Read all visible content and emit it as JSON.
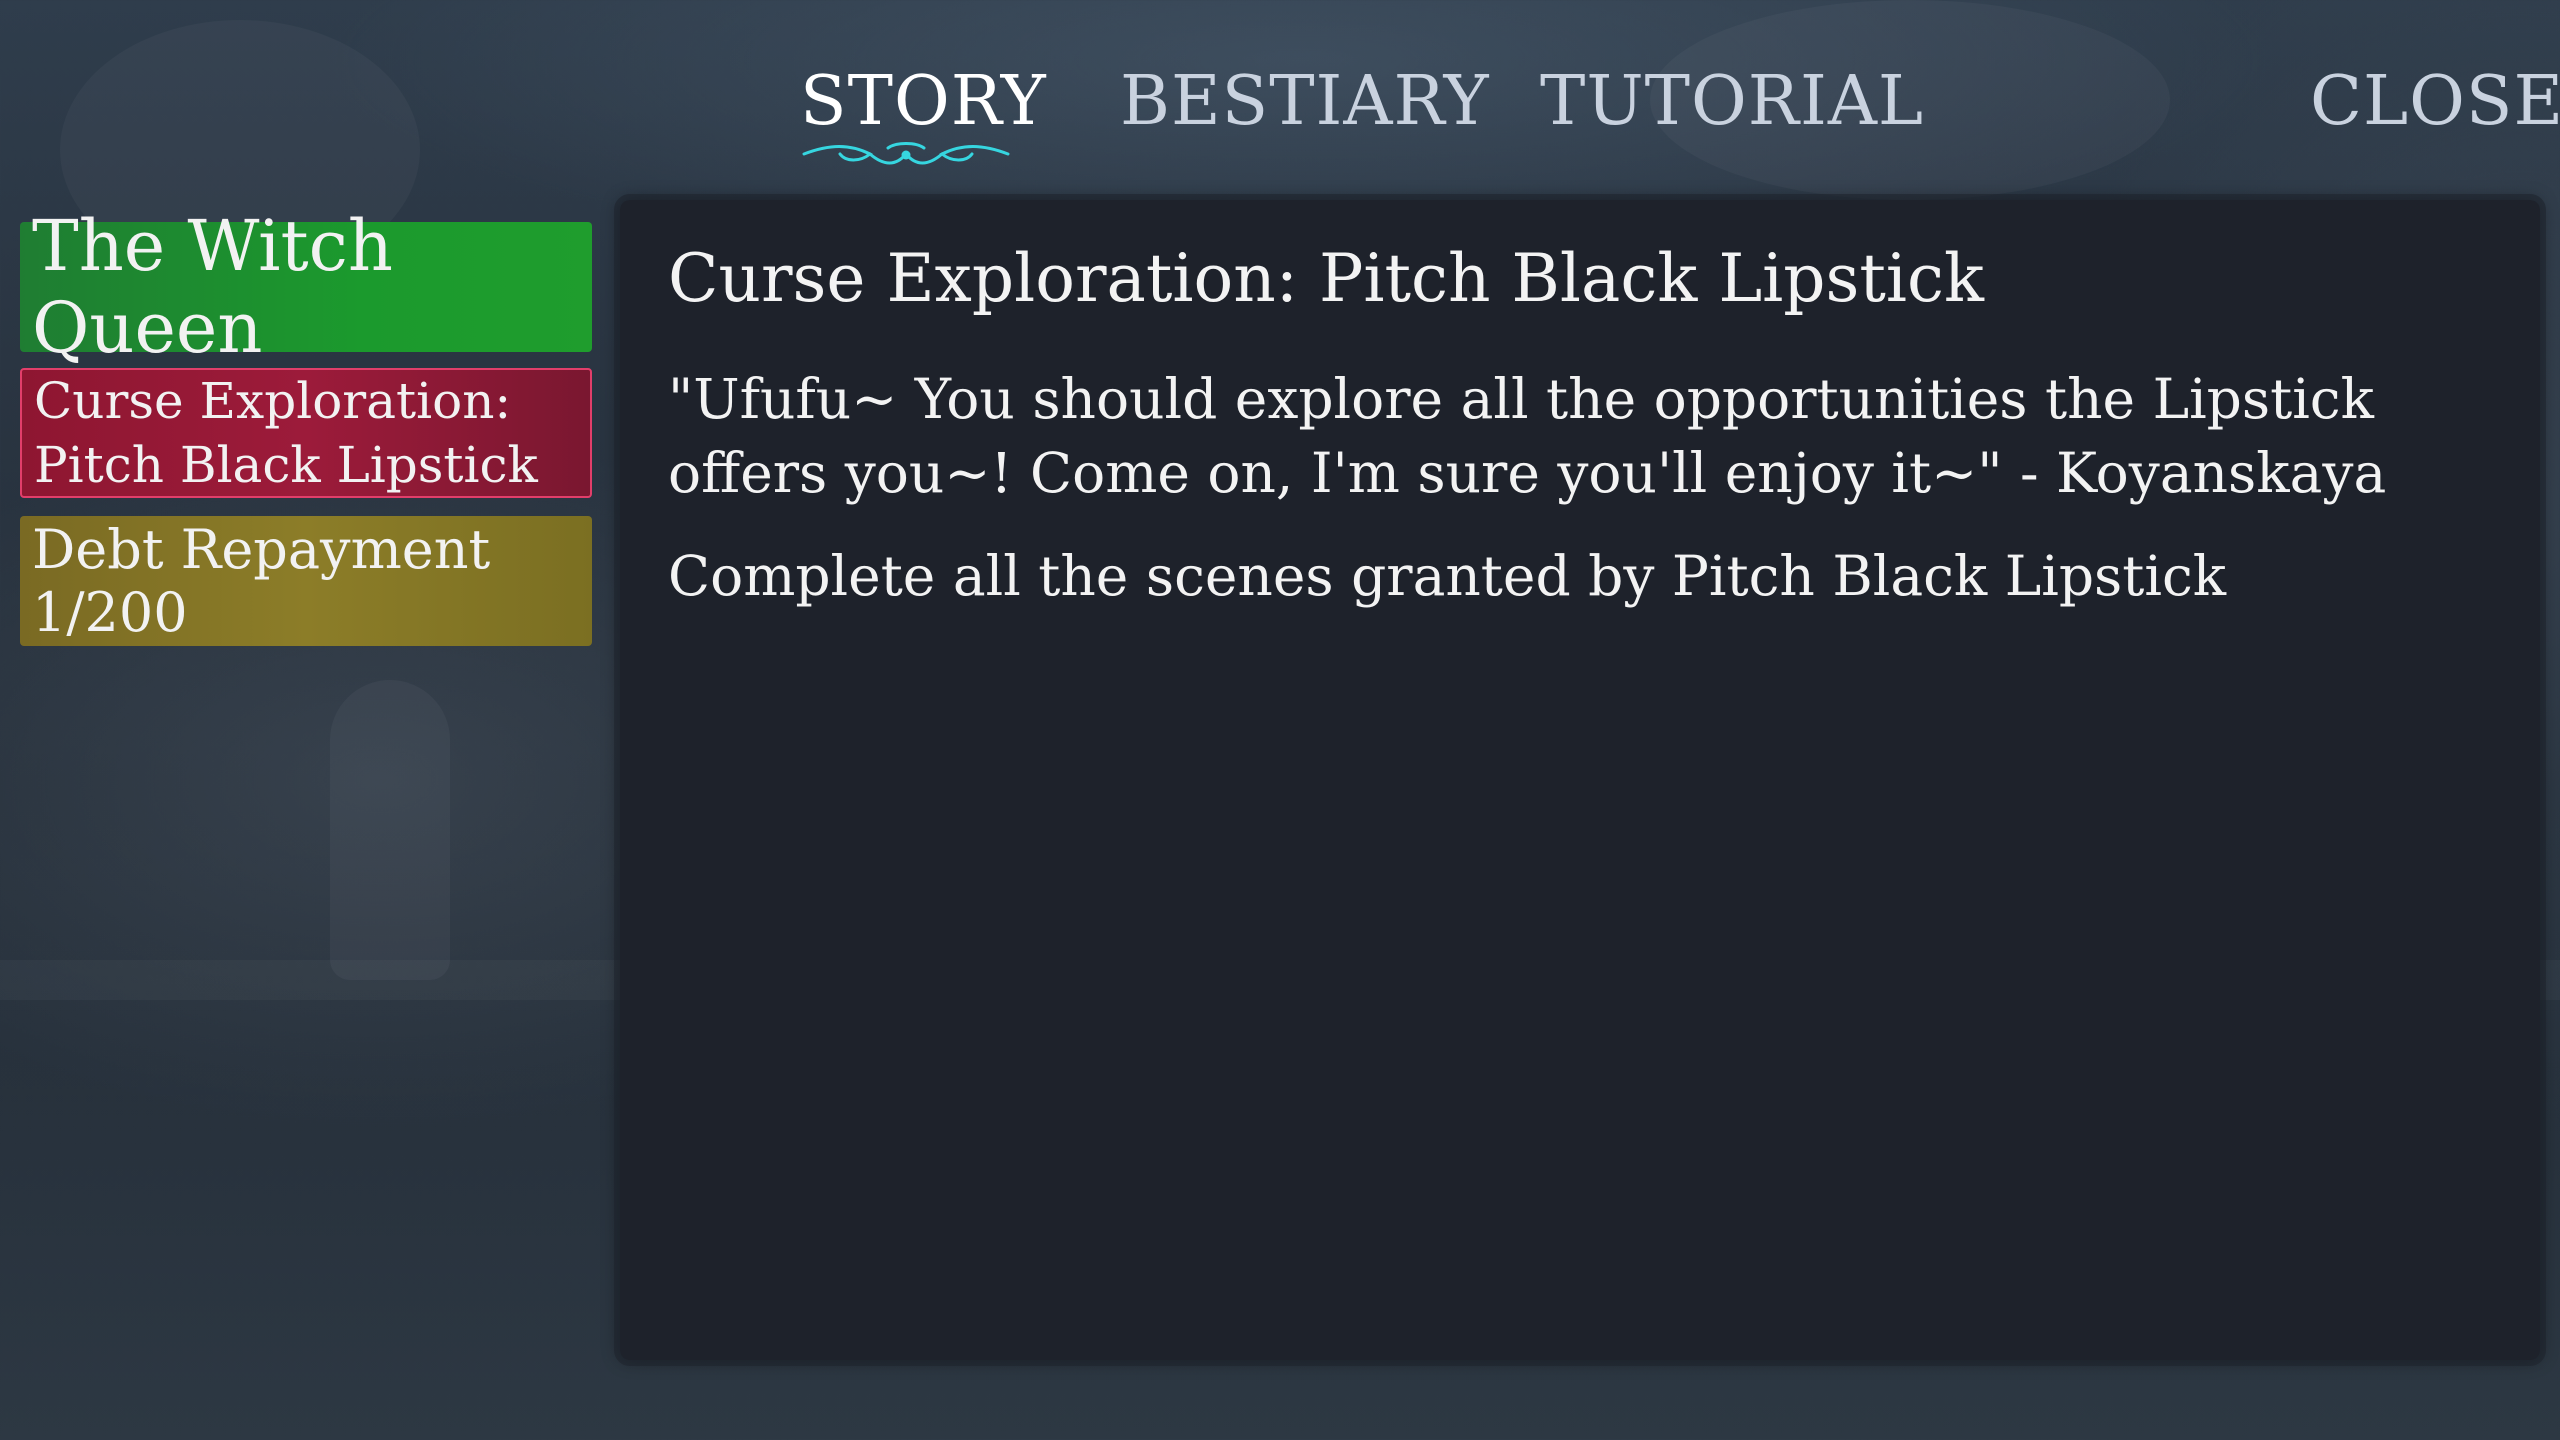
{
  "nav": {
    "tabs": [
      {
        "label": "STORY",
        "active": true
      },
      {
        "label": "BESTIARY",
        "active": false
      },
      {
        "label": "TUTORIAL",
        "active": false
      }
    ],
    "close_label": "CLOSE",
    "active_underline_icon": "ornate-flourish-icon"
  },
  "quest_list": {
    "items": [
      {
        "label": "The Witch Queen",
        "color": "#1b9a2d"
      },
      {
        "label": "Curse Exploration: Pitch Black Lipstick",
        "color": "#9c1b3a",
        "selected": true
      },
      {
        "label": "Debt Repayment 1/200",
        "color": "#8c7d28"
      }
    ]
  },
  "detail": {
    "title": "Curse Exploration: Pitch Black Lipstick",
    "quote": "\"Ufufu~ You should explore all the opportunities the Lipstick offers you~! Come on, I'm sure you'll enjoy it~\" - Koyanskaya",
    "objective": "Complete all the scenes granted by Pitch Black Lipstick"
  },
  "colors": {
    "accent_flourish": "#36d6e0",
    "selected_border": "#e23e6a"
  }
}
